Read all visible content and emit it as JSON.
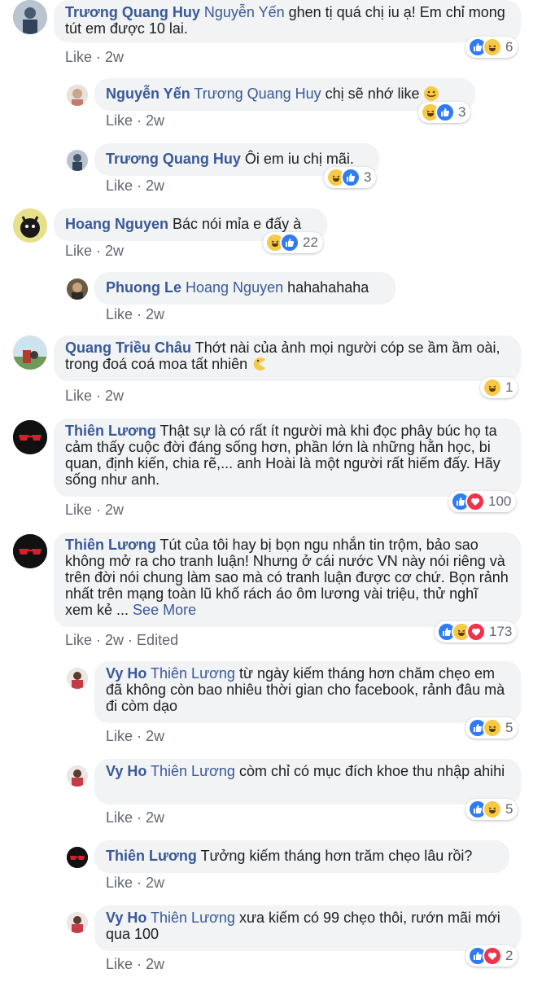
{
  "comments": [
    {
      "author": "Trương Quang Huy",
      "mention": "Nguyễn Yến",
      "text": "ghen tị quá chị iu ạ! Em chỉ mong tút em được 10 lai.",
      "like": "Like",
      "time": "2w",
      "reactions": {
        "types": [
          "like",
          "haha"
        ],
        "count": "6"
      }
    },
    {
      "author": "Nguyễn Yến",
      "mention": "Trương Quang Huy",
      "text": "chị sẽ nhớ like",
      "emoji": "smile",
      "like": "Like",
      "time": "2w",
      "reactions": {
        "types": [
          "haha",
          "like"
        ],
        "count": "3"
      }
    },
    {
      "author": "Trương Quang Huy",
      "mention": "",
      "text": "Ôi em iu chị mãi.",
      "like": "Like",
      "time": "2w",
      "reactions": {
        "types": [
          "haha",
          "like"
        ],
        "count": "3"
      }
    },
    {
      "author": "Hoang Nguyen",
      "mention": "",
      "text": "Bác nói mỉa e đấy à",
      "like": "Like",
      "time": "2w",
      "reactions": {
        "types": [
          "haha",
          "like"
        ],
        "count": "22"
      }
    },
    {
      "author": "Phuong Le",
      "mention": "Hoang Nguyen",
      "text": "hahahahaha",
      "like": "Like",
      "time": "2w"
    },
    {
      "author": "Quang Triều Châu",
      "mention": "",
      "text": "Thớt nài của ảnh mọi người cóp se ầm ầm oài, trong đoá coá moa tất nhiên",
      "emoji": "pacman",
      "like": "Like",
      "time": "2w",
      "reactions": {
        "types": [
          "haha"
        ],
        "count": "1"
      }
    },
    {
      "author": "Thiên Lương",
      "mention": "",
      "text": "Thật sự là có rất ít người mà khi đọc phây búc họ ta cảm thấy cuộc đời đáng sống hơn, phần lớn là những hằn học, bi quan, định kiến, chia rẽ,... anh Hoài là một người rất hiếm đấy. Hãy sống như anh.",
      "like": "Like",
      "time": "2w",
      "reactions": {
        "types": [
          "like",
          "love"
        ],
        "count": "100"
      }
    },
    {
      "author": "Thiên Lương",
      "mention": "",
      "text": "Tút của tôi hay bị bọn ngu nhắn tin trộm, bảo sao không mở ra cho tranh luận! Nhưng ở cái nước VN này nói riêng và trên đời nói chung làm sao mà có tranh luận được cơ chứ. Bọn rảnh nhất trên mạng toàn lũ khố rách áo ôm lương vài triệu, thử nghĩ xem kẻ ...",
      "see_more": "See More",
      "like": "Like",
      "time": "2w",
      "edited": "Edited",
      "reactions": {
        "types": [
          "like",
          "haha",
          "love"
        ],
        "count": "173"
      }
    },
    {
      "author": "Vy Ho",
      "mention": "Thiên Lương",
      "text": "từ ngày kiếm tháng hơn chăm chẹo em đã không còn bao nhiêu thời gian cho facebook, rảnh đâu mà đi còm dạo",
      "like": "Like",
      "time": "2w",
      "reactions": {
        "types": [
          "like",
          "haha"
        ],
        "count": "5"
      }
    },
    {
      "author": "Vy Ho",
      "mention": "Thiên Lương",
      "text": "còm chỉ có mục đích khoe thu nhập ahihi",
      "like": "Like",
      "time": "2w",
      "reactions": {
        "types": [
          "like",
          "haha"
        ],
        "count": "5"
      }
    },
    {
      "author": "Thiên Lương",
      "mention": "",
      "text": "Tưởng kiếm tháng hơn trăm chẹo lâu rồi?",
      "like": "Like",
      "time": "2w"
    },
    {
      "author": "Vy Ho",
      "mention": "Thiên Lương",
      "text": "xưa kiếm có 99 chẹo thôi, rướn mãi mới qua 100",
      "like": "Like",
      "time": "2w",
      "reactions": {
        "types": [
          "like",
          "love"
        ],
        "count": "2"
      }
    }
  ],
  "colors": {
    "link": "#385898",
    "bubble": "#f2f3f5",
    "meta": "#606770",
    "like_reaction": "#2f7cf6",
    "haha_reaction": "#f7c948",
    "love_reaction": "#f0334b"
  }
}
